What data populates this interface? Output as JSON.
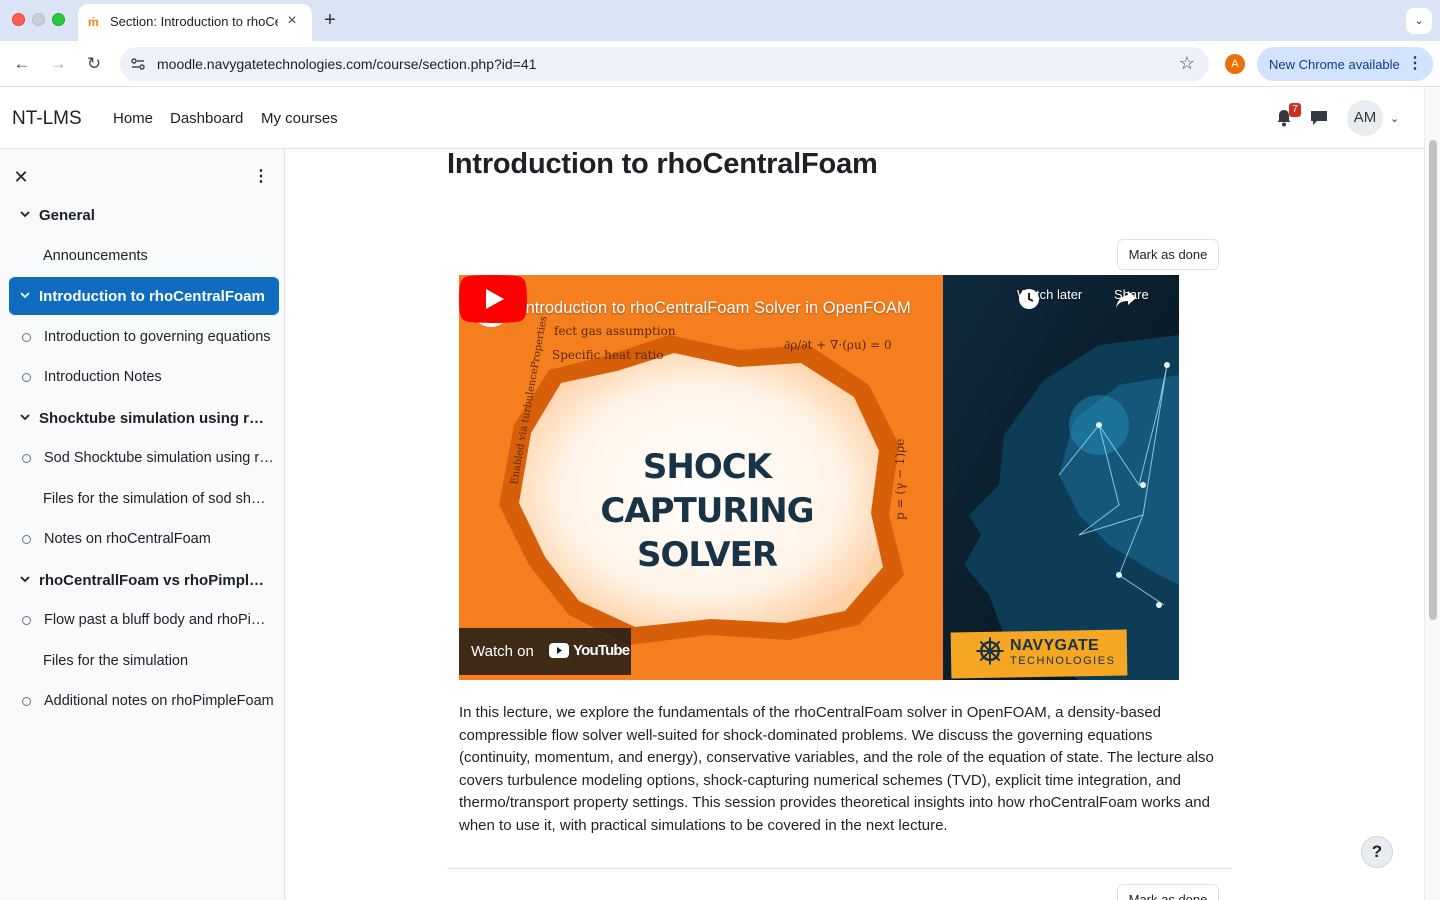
{
  "browser": {
    "tab_title": "Section: Introduction to rhoCentralFoam",
    "url": "moodle.navygatetechnologies.com/course/section.php?id=41",
    "profile_initial": "A",
    "update_label": "New Chrome available"
  },
  "navbar": {
    "brand": "NT-LMS",
    "links": [
      "Home",
      "Dashboard",
      "My courses"
    ],
    "notification_count": "7",
    "avatar_initials": "AM"
  },
  "course_index": {
    "items": [
      {
        "label": "General",
        "kind": "section"
      },
      {
        "label": "Announcements",
        "kind": "activity-plain"
      },
      {
        "label": "Introduction to rhoCentralFoam",
        "kind": "section",
        "active": true
      },
      {
        "label": "Introduction to governing equations",
        "kind": "activity"
      },
      {
        "label": "Introduction Notes",
        "kind": "activity"
      },
      {
        "label": "Shocktube simulation using rhoCentralFoam",
        "kind": "section"
      },
      {
        "label": "Sod Shocktube simulation using rhoCentralFoam",
        "kind": "activity"
      },
      {
        "label": "Files for the simulation of sod shocktube",
        "kind": "activity-plain"
      },
      {
        "label": "Notes on rhoCentralFoam",
        "kind": "activity"
      },
      {
        "label": "rhoCentrallFoam vs rhoPimpleFoam",
        "kind": "section"
      },
      {
        "label": "Flow past a bluff body and rhoPimpleFoam",
        "kind": "activity"
      },
      {
        "label": "Files for the simulation",
        "kind": "activity-plain"
      },
      {
        "label": "Additional notes on rhoPimpleFoam",
        "kind": "activity"
      }
    ]
  },
  "main": {
    "title": "Introduction to rhoCentralFoam",
    "mark_done_label": "Mark as done",
    "video": {
      "title": "Introduction to rhoCentralFoam Solver in OpenFOAM",
      "watch_later": "Watch later",
      "share": "Share",
      "watch_on": "Watch on",
      "youtube": "YouTube",
      "thumb_lines": [
        "SHOCK",
        "CAPTURING",
        "SOLVER"
      ],
      "brand_name": "NAVYGATE",
      "brand_sub": "TECHNOLOGIES",
      "formula_1": "fect gas assumption",
      "formula_2": "Specific heat ratio",
      "formula_3": "∂ρ/∂t + ∇·(ρu) = 0",
      "formula_4": "p = (γ − 1)ρe",
      "formula_5": "Enabled via turbulenceProperties"
    },
    "summary": "In this lecture, we explore the fundamentals of the rhoCentralFoam solver in OpenFOAM, a density-based compressible flow solver well-suited for shock-dominated problems. We discuss the governing equations (continuity, momentum, and energy), conservative variables, and the role of the equation of state. The lecture also covers turbulence modeling options, shock-capturing numerical schemes (TVD), explicit time integration, and thermo/transport property settings. This session provides theoretical insights into how rhoCentralFoam works and when to use it, with practical simulations to be covered in the next lecture."
  },
  "help_label": "?",
  "colors": {
    "accent": "#0f6cbf",
    "youtube_red": "#ff0000",
    "badge": "#ca3120"
  }
}
